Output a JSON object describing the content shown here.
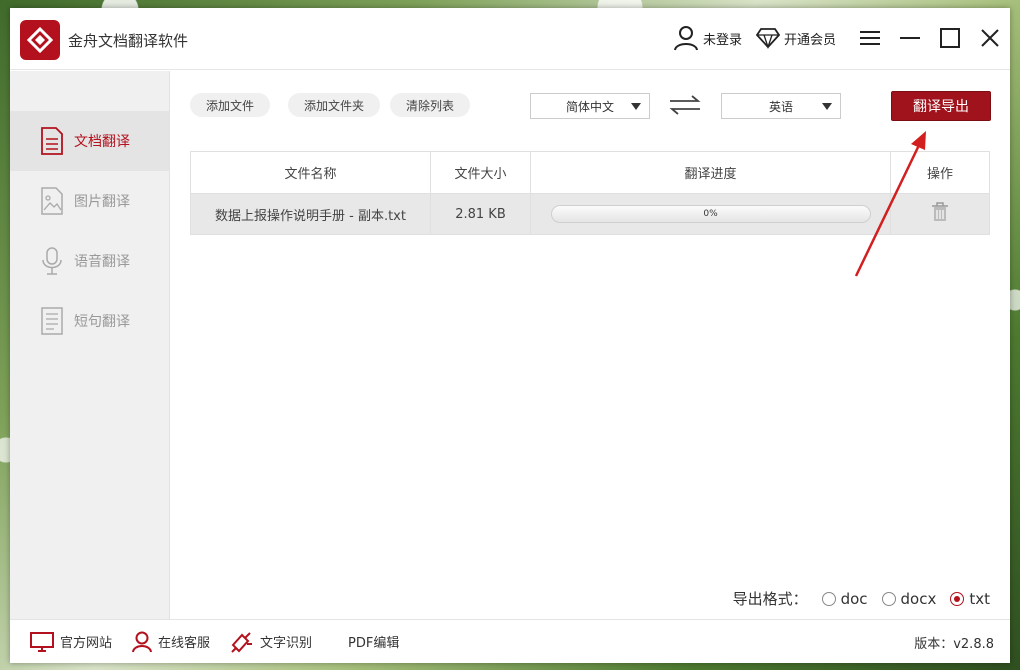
{
  "app": {
    "title": "金舟文档翻译软件",
    "brand_color": "#b3111d"
  },
  "header": {
    "login_label": "未登录",
    "vip_label": "开通会员",
    "menu_icon": "hamburger-icon",
    "minimize_icon": "minimize-icon",
    "maximize_icon": "maximize-icon",
    "close_icon": "close-icon"
  },
  "sidebar": {
    "items": [
      {
        "label": "文档翻译",
        "icon": "document-icon",
        "active": true
      },
      {
        "label": "图片翻译",
        "icon": "image-icon",
        "active": false
      },
      {
        "label": "语音翻译",
        "icon": "microphone-icon",
        "active": false
      },
      {
        "label": "短句翻译",
        "icon": "text-page-icon",
        "active": false
      }
    ]
  },
  "toolbar": {
    "add_file": "添加文件",
    "add_folder": "添加文件夹",
    "clear_list": "清除列表",
    "source_lang": "简体中文",
    "target_lang": "英语",
    "swap_icon": "swap-arrows-icon",
    "translate_export": "翻译导出"
  },
  "table": {
    "headers": [
      "文件名称",
      "文件大小",
      "翻译进度",
      "操作"
    ],
    "rows": [
      {
        "name": "数据上报操作说明手册 - 副本.txt",
        "size": "2.81 KB",
        "progress_text": "0%",
        "progress": 0,
        "action_icon": "trash-icon"
      }
    ]
  },
  "export": {
    "label": "导出格式：",
    "options": [
      "doc",
      "docx",
      "txt"
    ],
    "selected": "txt"
  },
  "footer": {
    "items": [
      {
        "label": "官方网站",
        "icon": "monitor-icon"
      },
      {
        "label": "在线客服",
        "icon": "user-service-icon"
      },
      {
        "label": "文字识别",
        "icon": "ocr-icon"
      },
      {
        "label": "PDF编辑",
        "icon": ""
      }
    ],
    "version": "版本：v2.8.8"
  }
}
